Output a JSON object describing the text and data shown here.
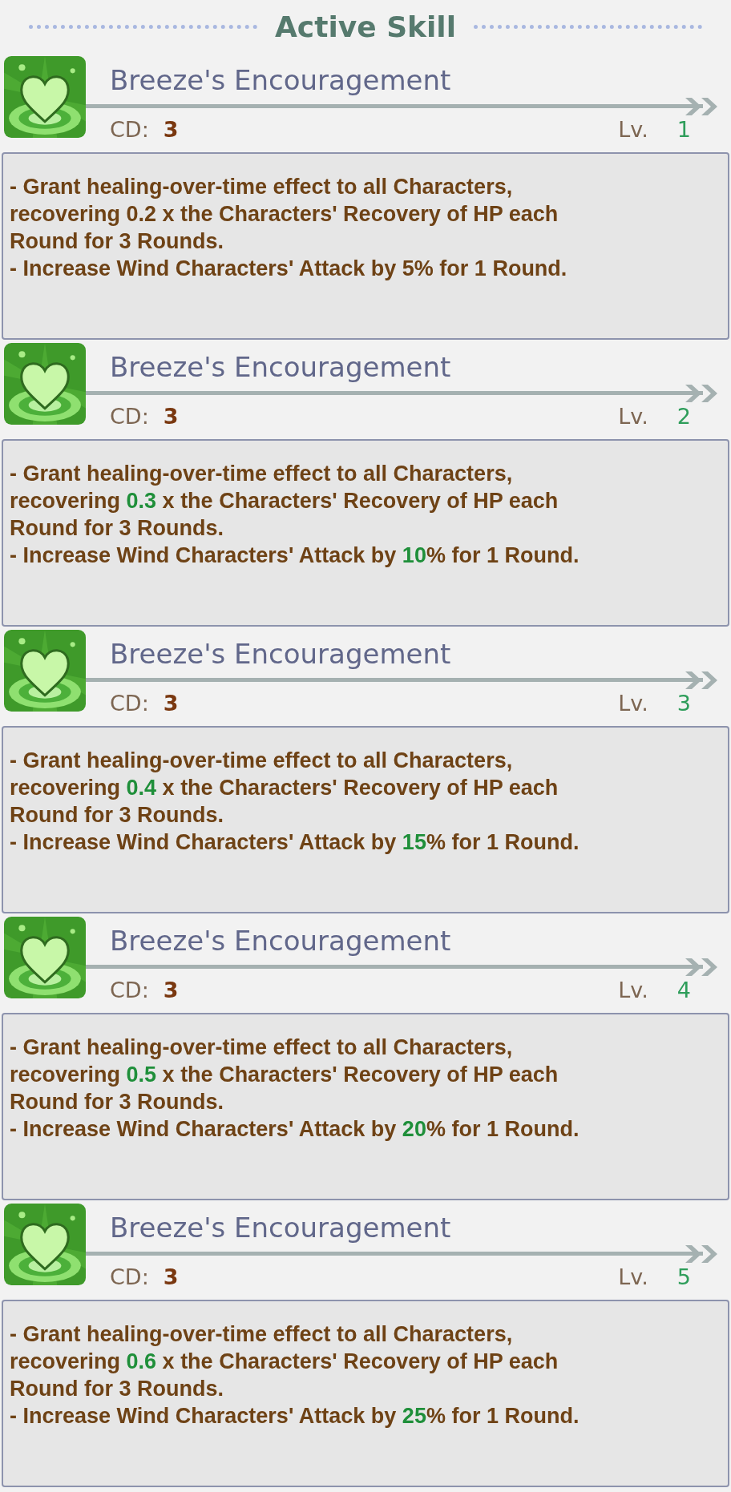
{
  "section_title": "Active Skill",
  "skills": [
    {
      "name": "Breeze's Encouragement",
      "cd_label": "CD:",
      "cd": "3",
      "level_label": "Lv.",
      "level": "1",
      "description": [
        [
          {
            "text": "- Grant healing-over-time effect to all Characters,",
            "highlighted": false
          }
        ],
        [
          {
            "text": "recovering 0.2 x the Characters' Recovery of HP each",
            "highlighted": false
          }
        ],
        [
          {
            "text": "Round for 3 Rounds.",
            "highlighted": false
          }
        ],
        [
          {
            "text": "- Increase Wind Characters' Attack by 5% for 1 Round.",
            "highlighted": false
          }
        ]
      ]
    },
    {
      "name": "Breeze's Encouragement",
      "cd_label": "CD:",
      "cd": "3",
      "level_label": "Lv.",
      "level": "2",
      "description": [
        [
          {
            "text": "- Grant healing-over-time effect to all Characters,",
            "highlighted": false
          }
        ],
        [
          {
            "text": "recovering ",
            "highlighted": false
          },
          {
            "text": "0.3",
            "highlighted": true
          },
          {
            "text": " x the Characters' Recovery of HP each",
            "highlighted": false
          }
        ],
        [
          {
            "text": "Round for 3 Rounds.",
            "highlighted": false
          }
        ],
        [
          {
            "text": "- Increase Wind Characters' Attack by ",
            "highlighted": false
          },
          {
            "text": "10",
            "highlighted": true
          },
          {
            "text": "% for 1 Round.",
            "highlighted": false
          }
        ]
      ]
    },
    {
      "name": "Breeze's Encouragement",
      "cd_label": "CD:",
      "cd": "3",
      "level_label": "Lv.",
      "level": "3",
      "description": [
        [
          {
            "text": "- Grant healing-over-time effect to all Characters,",
            "highlighted": false
          }
        ],
        [
          {
            "text": "recovering ",
            "highlighted": false
          },
          {
            "text": "0.4",
            "highlighted": true
          },
          {
            "text": " x the Characters' Recovery of HP each",
            "highlighted": false
          }
        ],
        [
          {
            "text": "Round for 3 Rounds.",
            "highlighted": false
          }
        ],
        [
          {
            "text": "- Increase Wind Characters' Attack by ",
            "highlighted": false
          },
          {
            "text": "15",
            "highlighted": true
          },
          {
            "text": "% for 1 Round.",
            "highlighted": false
          }
        ]
      ]
    },
    {
      "name": "Breeze's Encouragement",
      "cd_label": "CD:",
      "cd": "3",
      "level_label": "Lv.",
      "level": "4",
      "description": [
        [
          {
            "text": "- Grant healing-over-time effect to all Characters,",
            "highlighted": false
          }
        ],
        [
          {
            "text": "recovering ",
            "highlighted": false
          },
          {
            "text": "0.5",
            "highlighted": true
          },
          {
            "text": " x the Characters' Recovery of HP each",
            "highlighted": false
          }
        ],
        [
          {
            "text": "Round for 3 Rounds.",
            "highlighted": false
          }
        ],
        [
          {
            "text": "- Increase Wind Characters' Attack by ",
            "highlighted": false
          },
          {
            "text": "20",
            "highlighted": true
          },
          {
            "text": "% for 1 Round.",
            "highlighted": false
          }
        ]
      ]
    },
    {
      "name": "Breeze's Encouragement",
      "cd_label": "CD:",
      "cd": "3",
      "level_label": "Lv.",
      "level": "5",
      "description": [
        [
          {
            "text": "- Grant healing-over-time effect to all Characters,",
            "highlighted": false
          }
        ],
        [
          {
            "text": "recovering ",
            "highlighted": false
          },
          {
            "text": "0.6",
            "highlighted": true
          },
          {
            "text": " x the Characters' Recovery of HP each",
            "highlighted": false
          }
        ],
        [
          {
            "text": "Round for 3 Rounds.",
            "highlighted": false
          }
        ],
        [
          {
            "text": "- Increase Wind Characters' Attack by ",
            "highlighted": false
          },
          {
            "text": "25",
            "highlighted": true
          },
          {
            "text": "% for 1 Round.",
            "highlighted": false
          }
        ]
      ]
    }
  ]
}
